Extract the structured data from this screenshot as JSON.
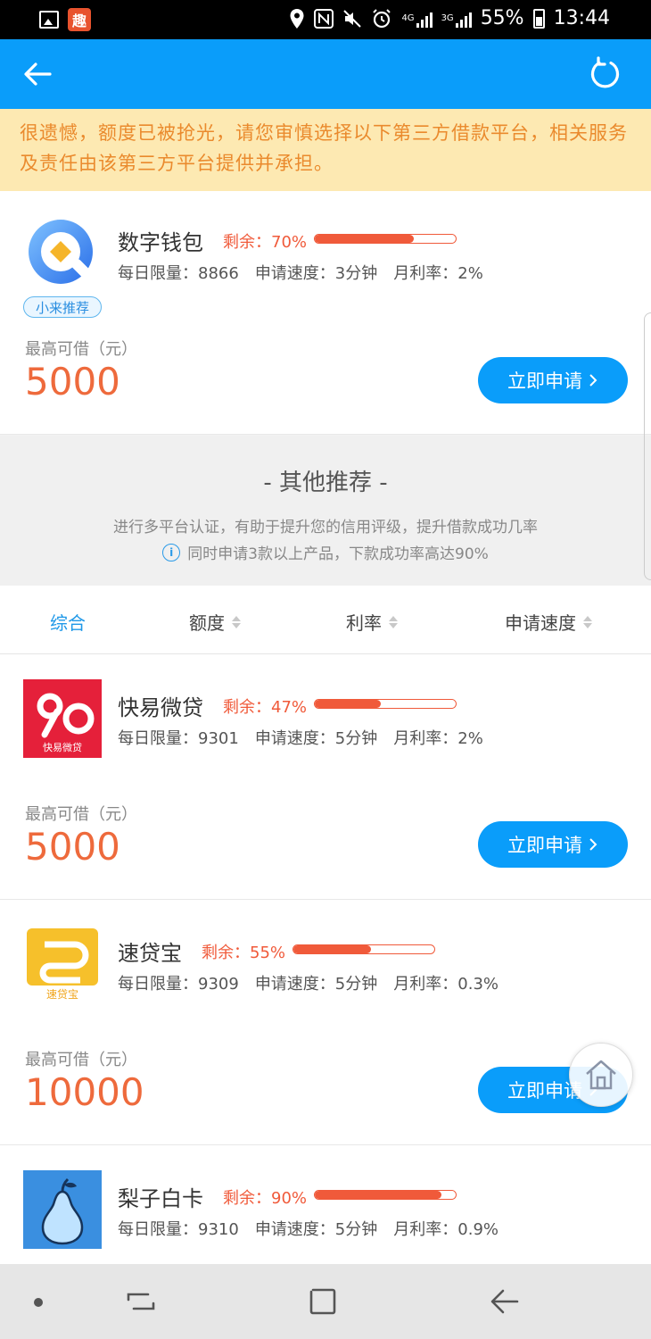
{
  "status_bar": {
    "app_badge": "趣",
    "network": "4G",
    "network2": "3G",
    "battery": "55%",
    "time": "13:44"
  },
  "notice": "很遗憾，额度已被抢光，请您审慎选择以下第三方借款平台，相关服务及责任由该第三方平台提供并承担。",
  "featured": {
    "name": "数字钱包",
    "remain_label": "剩余：70%",
    "remain_value": 0.7,
    "daily_limit": "每日限量：8866",
    "speed": "申请速度：3分钟",
    "rate": "月利率：2%",
    "badge": "小来推荐",
    "max_label": "最高可借（元）",
    "amount": "5000",
    "apply_label": "立即申请"
  },
  "other": {
    "title": "- 其他推荐 -",
    "subtitle": "进行多平台认证，有助于提升您的信用评级，提升借款成功几率",
    "tip": "同时申请3款以上产品，下款成功率高达90%"
  },
  "sort": {
    "items": [
      "综合",
      "额度",
      "利率",
      "申请速度"
    ]
  },
  "products": [
    {
      "name": "快易微贷",
      "logo_text": "快易微贷",
      "remain_label": "剩余：47%",
      "remain_value": 0.47,
      "daily_limit": "每日限量：9301",
      "speed": "申请速度：5分钟",
      "rate": "月利率：2%",
      "max_label": "最高可借（元）",
      "amount": "5000",
      "apply_label": "立即申请"
    },
    {
      "name": "速贷宝",
      "logo_text": "速贷宝",
      "remain_label": "剩余：55%",
      "remain_value": 0.55,
      "daily_limit": "每日限量：9309",
      "speed": "申请速度：5分钟",
      "rate": "月利率：0.3%",
      "max_label": "最高可借（元）",
      "amount": "10000",
      "apply_label": "立即申请"
    },
    {
      "name": "梨子白卡",
      "remain_label": "剩余：90%",
      "remain_value": 0.9,
      "daily_limit": "每日限量：9310",
      "speed": "申请速度：5分钟",
      "rate": "月利率：0.9%"
    }
  ],
  "colors": {
    "primary": "#0a9dfa",
    "accent": "#f05a3a",
    "notice_bg": "#fde9b2",
    "notice_text": "#ea8a2d"
  }
}
